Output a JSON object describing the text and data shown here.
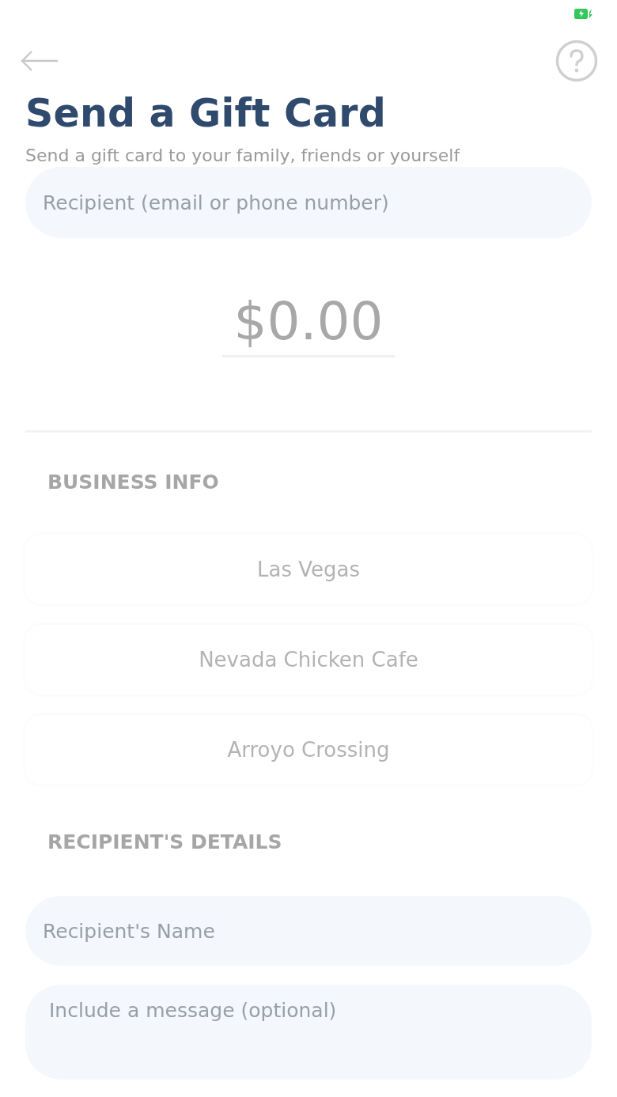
{
  "header": {
    "title": "Send a Gift Card",
    "subtitle": "Send a gift card to your family, friends or yourself"
  },
  "recipient_field": {
    "placeholder": "Recipient (email or phone number)"
  },
  "amount_field": {
    "placeholder": "$0.00"
  },
  "business_info": {
    "heading": "BUSINESS INFO",
    "items": [
      {
        "label": "Las Vegas"
      },
      {
        "label": "Nevada Chicken Cafe"
      },
      {
        "label": "Arroyo Crossing"
      }
    ]
  },
  "recipient_details": {
    "heading": "RECIPIENT'S DETAILS",
    "name_field": {
      "placeholder": "Recipient's Name"
    },
    "message_field": {
      "placeholder": "Include a message (optional)"
    }
  }
}
